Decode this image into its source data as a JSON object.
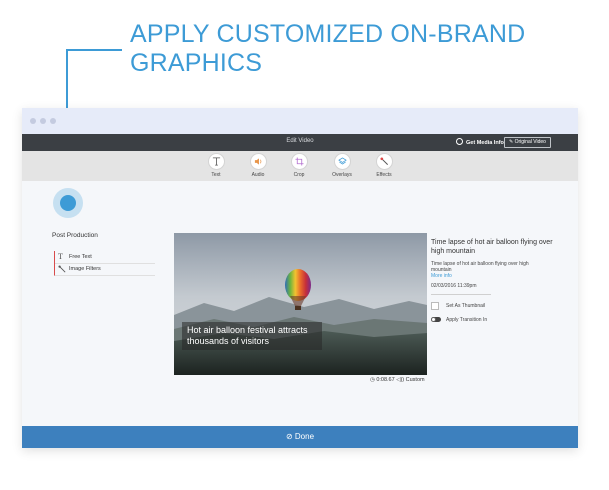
{
  "headline": {
    "line1": "APPLY CUSTOMIZED ON-BRAND",
    "line2": "GRAPHICS",
    "color": "#3d9bd6"
  },
  "window": {
    "title": "Edit Video",
    "get_media_info": "Get Media Info",
    "original_video": "Original Video"
  },
  "toolbar": {
    "items": [
      {
        "label": "Text",
        "icon": "text-icon"
      },
      {
        "label": "Audio",
        "icon": "speaker-icon"
      },
      {
        "label": "Crop",
        "icon": "crop-icon"
      },
      {
        "label": "Overlays",
        "icon": "layers-icon"
      },
      {
        "label": "Effects",
        "icon": "wand-icon"
      }
    ]
  },
  "post_production": {
    "title": "Post Production",
    "items": [
      {
        "label": "Free Text",
        "icon": "text-icon"
      },
      {
        "label": "Image Filters",
        "icon": "wand-icon"
      }
    ]
  },
  "video": {
    "caption_line1": "Hot air balloon festival attracts",
    "caption_line2": "thousands of visitors",
    "timecode": "0:08.67",
    "mode": "Custom"
  },
  "info": {
    "title": "Time lapse of hot air balloon flying over high mountain",
    "description": "Time lapse of hot air balloon flying over high mountain",
    "more_info": "More info",
    "date": "02/03/2016 11:39pm",
    "set_thumbnail": "Set As Thumbnail",
    "apply_transition": "Apply Transition In"
  },
  "done_label": "Done",
  "colors": {
    "accent": "#3d9bd6",
    "app_bar": "#3b3f44",
    "done_bar": "#3d80be",
    "active_marker": "#d84b4b"
  }
}
